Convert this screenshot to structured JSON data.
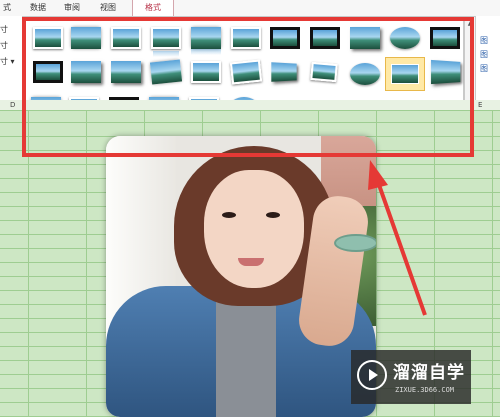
{
  "ribbon_tabs": [
    {
      "label": "式",
      "active": false
    },
    {
      "label": "数据",
      "active": false
    },
    {
      "label": "审阅",
      "active": false
    },
    {
      "label": "视图",
      "active": false
    },
    {
      "label": "格式",
      "active": true
    }
  ],
  "left_options": [
    "寸",
    "寸",
    "寸 ▾"
  ],
  "gallery": {
    "selected_index": 17,
    "styles": [
      "simple-frame-white",
      "soft-edge",
      "double-frame-black",
      "reflected-bevel",
      "reflected-rounded",
      "simple-frame-black",
      "thick-matte-black",
      "simple-frame-black",
      "soft-edge-rectangle",
      "oval-bevel",
      "black-frame",
      "compound-frame-black",
      "drop-shadow",
      "shadow-rectangle",
      "rounded-diagonal",
      "reflected",
      "rotated-white",
      "perspective-shadow",
      "relaxed-perspective",
      "soft-edge-oval",
      "bevel-rectangle",
      "perspective-reflected",
      "beveled-matte",
      "moderate-frame",
      "metal-frame",
      "center-shadow",
      "bevel-perspective",
      "metal-oval"
    ]
  },
  "scroll": {
    "up": "▲",
    "more": "▾"
  },
  "right_buttons": [
    "图",
    "图",
    "图"
  ],
  "column_headers": [
    "D",
    "E"
  ],
  "watermark": {
    "title": "溜溜自学",
    "subtitle": "ZIXUE.3D66.COM"
  }
}
